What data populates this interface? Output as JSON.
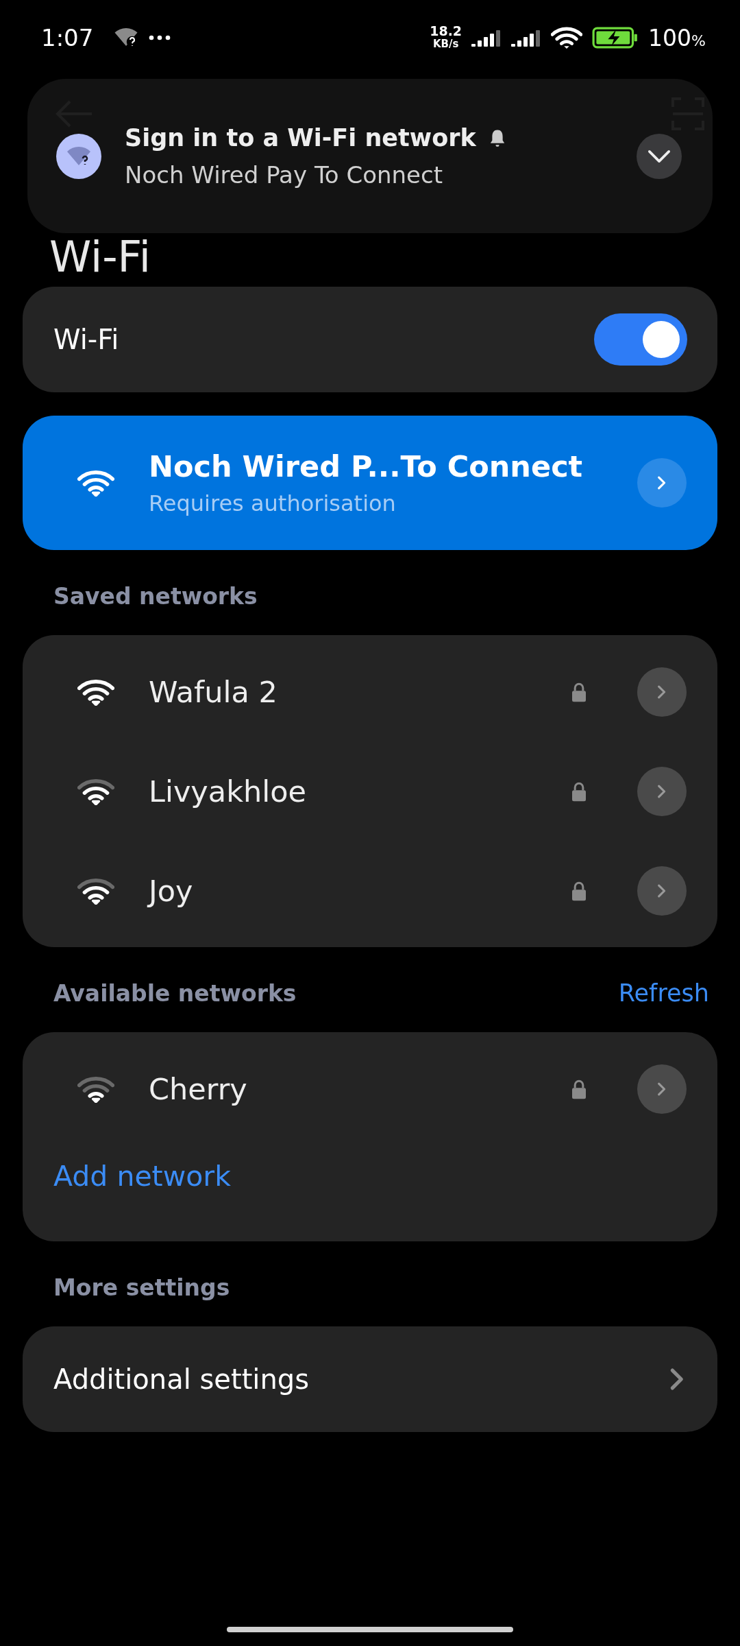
{
  "status_bar": {
    "time": "1:07",
    "net_speed_value": "18.2",
    "net_speed_unit": "KB/s",
    "battery": "100",
    "battery_unit": "%"
  },
  "notification": {
    "title": "Sign in to a Wi-Fi network",
    "text": "Noch Wired Pay To Connect",
    "expanded": false
  },
  "header": {
    "title": "Wi-Fi"
  },
  "wifi_toggle": {
    "label": "Wi-Fi",
    "on": true
  },
  "connected": {
    "name": "Noch Wired P...To Connect",
    "status": "Requires authorisation"
  },
  "saved_networks": {
    "heading": "Saved networks",
    "items": [
      {
        "name": "Wafula 2",
        "kind": "full",
        "locked": true
      },
      {
        "name": "Livyakhloe",
        "kind": "good",
        "locked": true
      },
      {
        "name": "Joy",
        "kind": "good",
        "locked": true
      }
    ]
  },
  "available_networks": {
    "heading": "Available networks",
    "refresh": "Refresh",
    "items": [
      {
        "name": "Cherry",
        "kind": "fair",
        "locked": true
      }
    ],
    "add": "Add network"
  },
  "more_settings": {
    "heading": "More settings",
    "items": [
      {
        "label": "Additional settings"
      }
    ]
  }
}
